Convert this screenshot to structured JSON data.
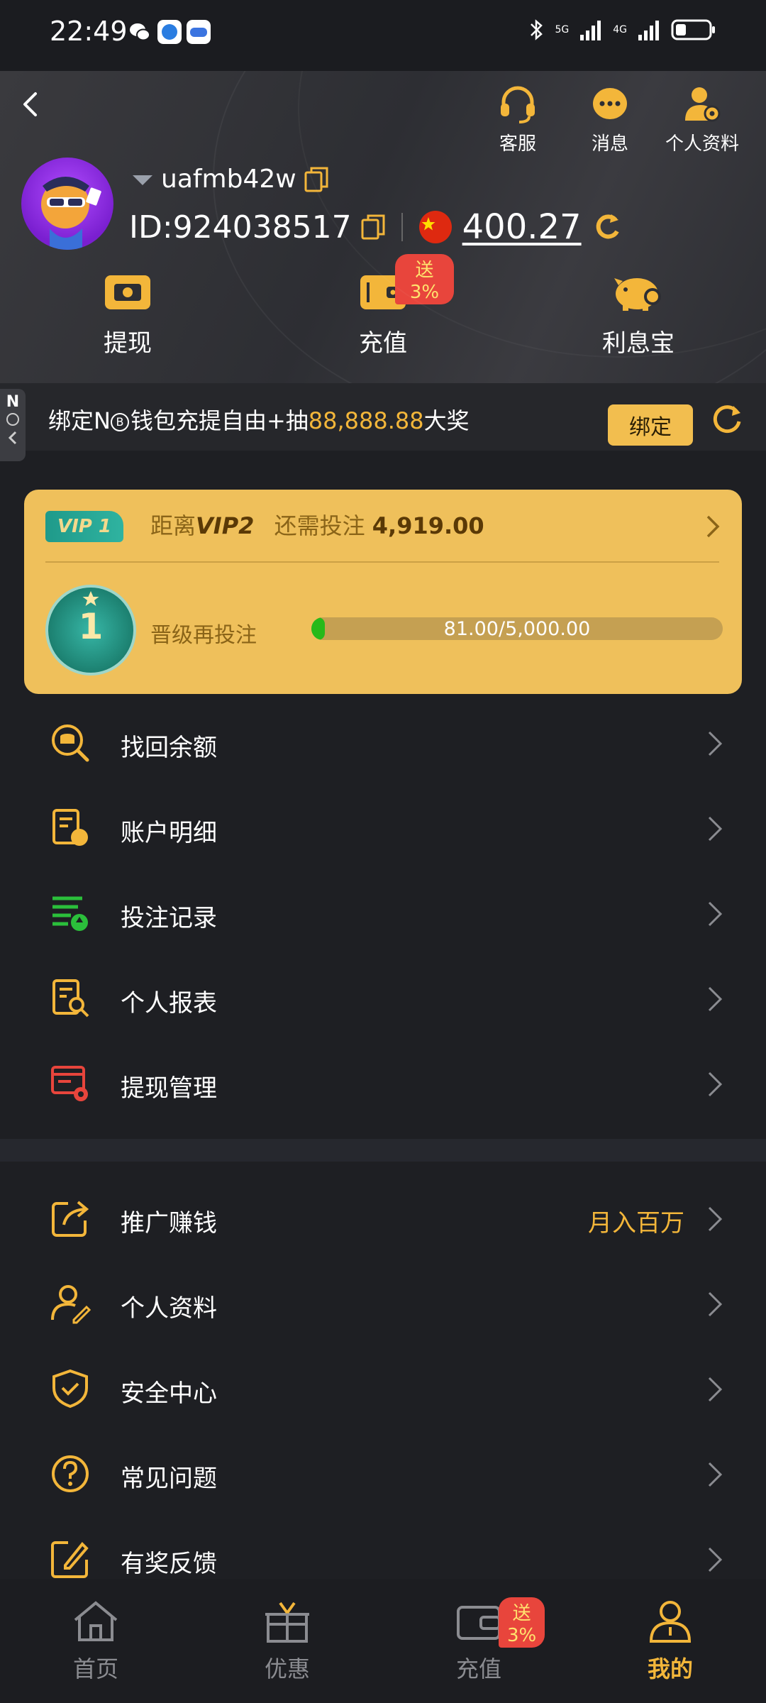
{
  "status_bar": {
    "time": "22:49",
    "network_5g": "5G",
    "network_4g": "4G"
  },
  "header": {
    "top_actions": [
      {
        "label": "客服",
        "icon": "headset-icon"
      },
      {
        "label": "消息",
        "icon": "message-icon"
      },
      {
        "label": "个人资料",
        "icon": "profile-settings-icon"
      }
    ],
    "username": "uafmb42w",
    "id_label": "ID:924038517",
    "balance": "400.27",
    "quick_actions": [
      {
        "label": "提现",
        "icon": "withdraw-icon"
      },
      {
        "label": "充值",
        "icon": "wallet-icon",
        "badge": "送3%"
      },
      {
        "label": "利息宝",
        "icon": "piggy-bank-icon"
      }
    ]
  },
  "bind_bar": {
    "text_a": "绑定N",
    "text_b": "钱包充提自由+抽",
    "highlight": "88,888.88",
    "text_c": "大奖",
    "button": "绑定",
    "side_tab": "N"
  },
  "vip": {
    "badge": "VIP 1",
    "text_prefix": "距离",
    "target": "VIP2",
    "text_mid": "还需投注",
    "amount": "4,919.00",
    "medal_level": "1",
    "promo_label": "晋级再投注",
    "progress_text": "81.00/5,000.00",
    "progress_fraction": 0.0162
  },
  "menu_group_1": [
    {
      "label": "找回余额",
      "icon": "coin-search-icon"
    },
    {
      "label": "账户明细",
      "icon": "account-detail-icon"
    },
    {
      "label": "投注记录",
      "icon": "bet-record-icon"
    },
    {
      "label": "个人报表",
      "icon": "report-search-icon"
    },
    {
      "label": "提现管理",
      "icon": "withdraw-settings-icon"
    }
  ],
  "menu_group_2": [
    {
      "label": "推广赚钱",
      "icon": "share-icon",
      "extra": "月入百万"
    },
    {
      "label": "个人资料",
      "icon": "user-edit-icon"
    },
    {
      "label": "安全中心",
      "icon": "shield-check-icon"
    },
    {
      "label": "常见问题",
      "icon": "question-icon"
    },
    {
      "label": "有奖反馈",
      "icon": "feedback-edit-icon"
    }
  ],
  "bottom_nav": [
    {
      "label": "首页",
      "icon": "home-icon"
    },
    {
      "label": "优惠",
      "icon": "gift-icon"
    },
    {
      "label": "充值",
      "icon": "wallet-icon",
      "badge": "送3%"
    },
    {
      "label": "我的",
      "icon": "user-icon",
      "active": true
    }
  ],
  "colors": {
    "accent": "#f3b63a",
    "vip_card": "#efc05b",
    "background": "#1e1f23",
    "badge_red": "#e8453c",
    "progress_green": "#27b91a"
  }
}
